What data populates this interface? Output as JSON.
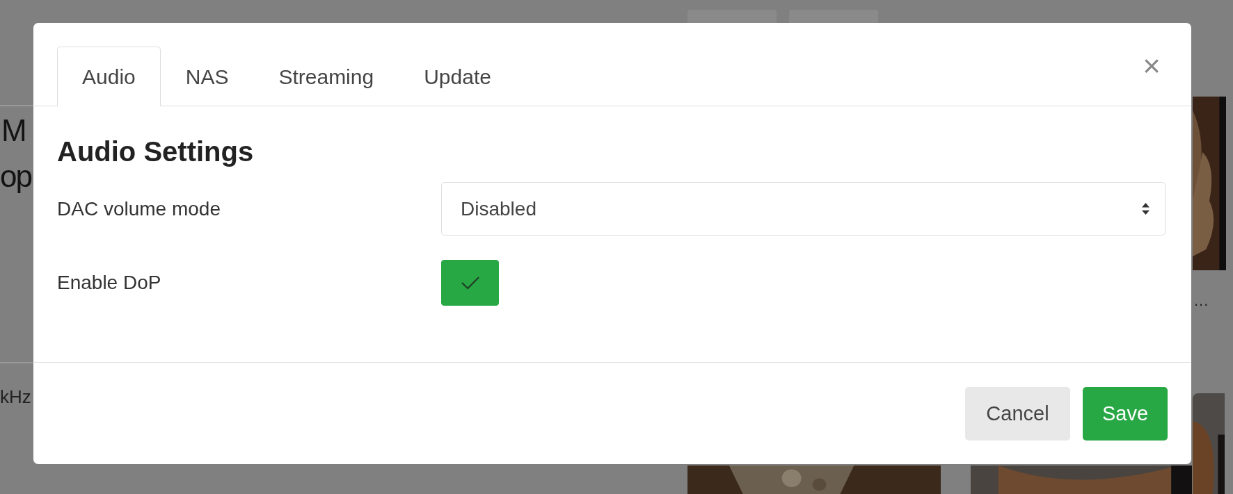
{
  "background": {
    "texts": [
      {
        "kind": "title",
        "text": "M"
      },
      {
        "kind": "title",
        "text": "op"
      },
      {
        "kind": "small",
        "text": "kHz"
      },
      {
        "kind": "small",
        "text": "..."
      }
    ]
  },
  "dialog": {
    "tabs": [
      {
        "label": "Audio",
        "selected": true
      },
      {
        "label": "NAS",
        "selected": false
      },
      {
        "label": "Streaming",
        "selected": false
      },
      {
        "label": "Update",
        "selected": false
      }
    ],
    "close": "×",
    "heading": "Audio Settings",
    "settings": [
      {
        "kind": "select",
        "label": "DAC volume mode",
        "value": "Disabled"
      },
      {
        "kind": "checkbox",
        "label": "Enable DoP",
        "checked": true
      }
    ],
    "buttons": [
      {
        "kind": "secondary",
        "label": "Cancel"
      },
      {
        "kind": "primary",
        "label": "Save"
      }
    ]
  }
}
